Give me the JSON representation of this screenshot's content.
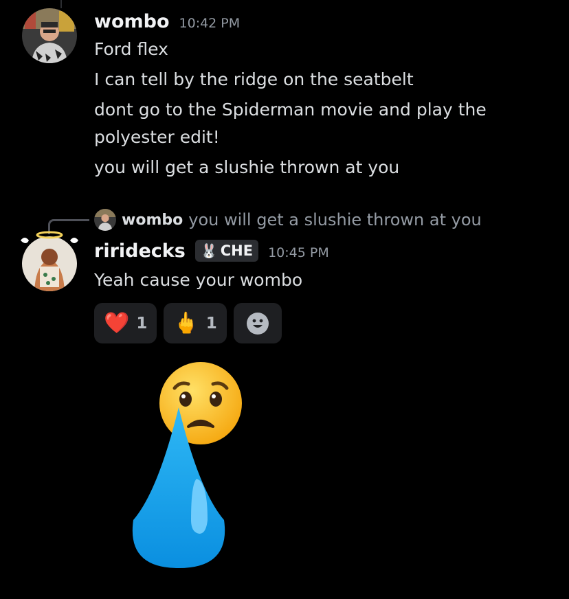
{
  "messages": [
    {
      "author": "wombo",
      "time": "10:42 PM",
      "lines": [
        "Ford flex",
        "I can tell by the ridge on the seatbelt",
        "dont go to the Spiderman movie and play the",
        "polyester edit!",
        "you will get a slushie thrown at you"
      ]
    },
    {
      "reply_to": {
        "author": "wombo",
        "text": "you will get a slushie thrown at you"
      },
      "author": "riridecks",
      "tag": {
        "icon": "bunny-icon",
        "glyph": "🐰",
        "text": "CHE"
      },
      "time": "10:45 PM",
      "lines": [
        "Yeah cause your wombo"
      ],
      "reactions": [
        {
          "emoji": "❤️",
          "icon": "red-heart-icon",
          "count": "1"
        },
        {
          "emoji": "🖕",
          "icon": "middle-finger-icon",
          "count": "1"
        }
      ]
    }
  ],
  "big_emoji": {
    "icon": "worried-face-with-teardrop-icon"
  },
  "colors": {
    "background": "#000000",
    "text": "#dbdee1",
    "muted": "#949ba4",
    "reaction_bg": "#1e1f22",
    "teardrop": "#1aa3f0",
    "face": "#fcc21b"
  }
}
